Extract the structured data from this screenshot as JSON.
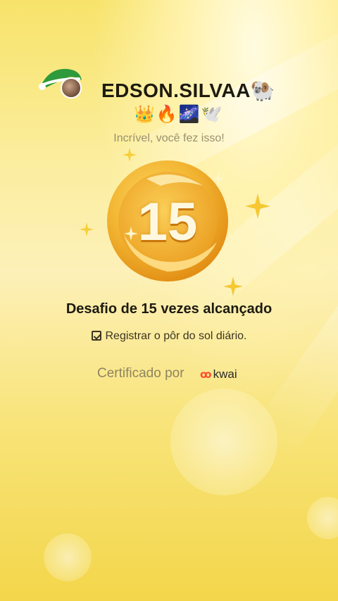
{
  "header": {
    "username": "EDSON.SILVAA",
    "username_emoji": "🐏",
    "emoji_row": "👑🔥🌌🕊️"
  },
  "subtitle": "Incrível, você fez isso!",
  "medal": {
    "number": "15"
  },
  "achievement": {
    "title": "Desafio de 15 vezes alcançado",
    "task": "Registrar o pôr do sol diário."
  },
  "certification": {
    "label": "Certificado por",
    "brand": "kwai"
  },
  "colors": {
    "medal_gold": "#f2b531",
    "medal_dark": "#e08a12",
    "text_dark": "#1d1a10",
    "brand_orange": "#ff4b2b"
  }
}
